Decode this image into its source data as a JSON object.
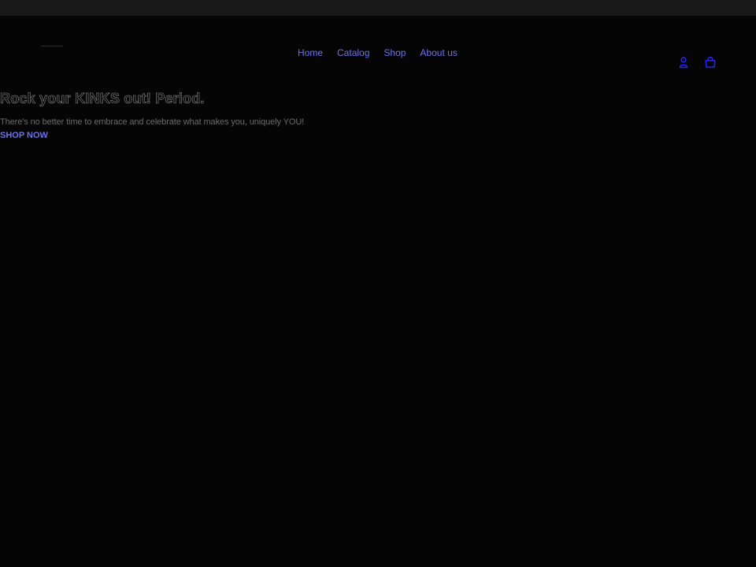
{
  "nav": {
    "items": [
      {
        "label": "Home"
      },
      {
        "label": "Catalog"
      },
      {
        "label": "Shop"
      },
      {
        "label": "About us"
      }
    ]
  },
  "header_icons": {
    "account": "user-icon",
    "cart": "shopping-bag-icon",
    "color": "#2323ff"
  },
  "hero": {
    "title": "Rock your KINKS out! Period.",
    "subtitle": "There's no better time to embrace and celebrate what makes you, uniquely YOU!",
    "cta_label": "SHOP NOW"
  },
  "colors": {
    "background": "#050505",
    "topbar": "#191919",
    "link": "#6f6fe8"
  }
}
